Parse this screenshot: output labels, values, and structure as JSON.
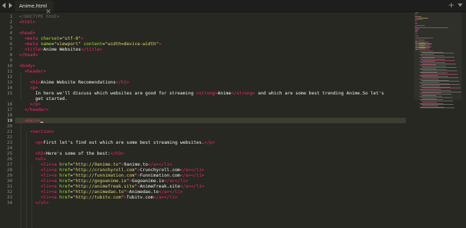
{
  "tab": {
    "label": "Anime.html"
  },
  "colors": {
    "background": "#272822",
    "tag": "#f92672",
    "attribute": "#a6e22e",
    "string": "#e6db74",
    "text": "#f8f8f2",
    "gutter_text": "#90908a"
  },
  "icons": {
    "back": "chevron-left-icon",
    "forward": "chevron-right-icon",
    "close": "close-icon",
    "new_tab": "plus-icon",
    "tab_list": "chevron-down-icon"
  },
  "editor": {
    "active_line": 19,
    "lines": [
      {
        "n": "1",
        "tokens": [
          {
            "k": "doc",
            "t": "<!DOCTYPE html>"
          }
        ]
      },
      {
        "n": "2",
        "tokens": [
          {
            "k": "tag",
            "t": "<html>"
          }
        ]
      },
      {
        "n": "3",
        "tokens": []
      },
      {
        "n": "4",
        "tokens": [
          {
            "k": "tag",
            "t": "<head>"
          }
        ]
      },
      {
        "n": "5",
        "tokens": [
          {
            "k": "txt",
            "t": "  "
          },
          {
            "k": "tag",
            "t": "<meta "
          },
          {
            "k": "attr",
            "t": "charset"
          },
          {
            "k": "txt",
            "t": "="
          },
          {
            "k": "str",
            "t": "\"utf-8\""
          },
          {
            "k": "tag",
            "t": ">"
          }
        ]
      },
      {
        "n": "6",
        "tokens": [
          {
            "k": "txt",
            "t": "  "
          },
          {
            "k": "tag",
            "t": "<meta "
          },
          {
            "k": "attr",
            "t": "name"
          },
          {
            "k": "txt",
            "t": "="
          },
          {
            "k": "str",
            "t": "\"viewport\""
          },
          {
            "k": "txt",
            "t": " "
          },
          {
            "k": "attr",
            "t": "content"
          },
          {
            "k": "txt",
            "t": "="
          },
          {
            "k": "str",
            "t": "\"width=device-width\""
          },
          {
            "k": "tag",
            "t": ">"
          }
        ]
      },
      {
        "n": "7",
        "tokens": [
          {
            "k": "txt",
            "t": "  "
          },
          {
            "k": "tag",
            "t": "<title>"
          },
          {
            "k": "txt",
            "t": "Anime Websites"
          },
          {
            "k": "tag",
            "t": "</title>"
          }
        ]
      },
      {
        "n": "8",
        "tokens": [
          {
            "k": "tag",
            "t": "</head>"
          }
        ]
      },
      {
        "n": "9",
        "tokens": []
      },
      {
        "n": "10",
        "tokens": [
          {
            "k": "tag",
            "t": "<body>"
          }
        ]
      },
      {
        "n": "11",
        "tokens": [
          {
            "k": "txt",
            "t": "  "
          },
          {
            "k": "tag",
            "t": "<header>"
          }
        ]
      },
      {
        "n": "12",
        "tokens": []
      },
      {
        "n": "13",
        "tokens": [
          {
            "k": "txt",
            "t": "    "
          },
          {
            "k": "tag",
            "t": "<h1>"
          },
          {
            "k": "txt",
            "t": "Anime Website Recomendations"
          },
          {
            "k": "tag",
            "t": "</h1>"
          }
        ]
      },
      {
        "n": "14",
        "tokens": [
          {
            "k": "txt",
            "t": "    "
          },
          {
            "k": "tag",
            "t": "<p>"
          }
        ]
      },
      {
        "n": "15",
        "tokens": [
          {
            "k": "txt",
            "t": "      In here we'll discuss which websites are good for streaming "
          },
          {
            "k": "tag",
            "t": "<strong>"
          },
          {
            "k": "txt",
            "t": "Anime"
          },
          {
            "k": "tag",
            "t": "</strong>"
          },
          {
            "k": "txt",
            "t": " and which are some best trending Anime.So let's"
          }
        ]
      },
      {
        "n": "",
        "tokens": [
          {
            "k": "txt",
            "t": "      get started."
          }
        ]
      },
      {
        "n": "16",
        "tokens": [
          {
            "k": "txt",
            "t": "    "
          },
          {
            "k": "tag",
            "t": "</p>"
          }
        ]
      },
      {
        "n": "17",
        "tokens": [
          {
            "k": "txt",
            "t": "  "
          },
          {
            "k": "tag",
            "t": "</header>"
          }
        ]
      },
      {
        "n": "18",
        "tokens": []
      },
      {
        "n": "19",
        "tokens": [
          {
            "k": "txt",
            "t": "  "
          },
          {
            "k": "tag",
            "t": "<main>"
          }
        ]
      },
      {
        "n": "20",
        "tokens": []
      },
      {
        "n": "21",
        "tokens": [
          {
            "k": "txt",
            "t": "    "
          },
          {
            "k": "tag",
            "t": "<section>"
          }
        ]
      },
      {
        "n": "22",
        "tokens": []
      },
      {
        "n": "23",
        "tokens": [
          {
            "k": "txt",
            "t": "      "
          },
          {
            "k": "tag",
            "t": "<p>"
          },
          {
            "k": "txt",
            "t": "First let's find out which are some best streaming websites."
          },
          {
            "k": "tag",
            "t": "</p>"
          }
        ]
      },
      {
        "n": "24",
        "tokens": []
      },
      {
        "n": "25",
        "tokens": [
          {
            "k": "txt",
            "t": "      "
          },
          {
            "k": "tag",
            "t": "<h3>"
          },
          {
            "k": "txt",
            "t": "Here's some of the best:"
          },
          {
            "k": "tag",
            "t": "</h3>"
          }
        ]
      },
      {
        "n": "26",
        "tokens": [
          {
            "k": "txt",
            "t": "      "
          },
          {
            "k": "tag",
            "t": "<ul>"
          }
        ]
      },
      {
        "n": "27",
        "tokens": [
          {
            "k": "txt",
            "t": "        "
          },
          {
            "k": "tag",
            "t": "<li><a "
          },
          {
            "k": "attr",
            "t": "href"
          },
          {
            "k": "txt",
            "t": "="
          },
          {
            "k": "str",
            "t": "\"http://9anime.to\""
          },
          {
            "k": "tag",
            "t": ">"
          },
          {
            "k": "txt",
            "t": "9anime.to"
          },
          {
            "k": "tag",
            "t": "</a></li>"
          }
        ]
      },
      {
        "n": "28",
        "tokens": [
          {
            "k": "txt",
            "t": "        "
          },
          {
            "k": "tag",
            "t": "<li><a "
          },
          {
            "k": "attr",
            "t": "href"
          },
          {
            "k": "txt",
            "t": "="
          },
          {
            "k": "str",
            "t": "\"http://crunchyroll.com\""
          },
          {
            "k": "tag",
            "t": ">"
          },
          {
            "k": "txt",
            "t": "Crunchyroll.com"
          },
          {
            "k": "tag",
            "t": "</a></li>"
          }
        ]
      },
      {
        "n": "29",
        "tokens": [
          {
            "k": "txt",
            "t": "        "
          },
          {
            "k": "tag",
            "t": "<li><a "
          },
          {
            "k": "attr",
            "t": "href"
          },
          {
            "k": "txt",
            "t": "="
          },
          {
            "k": "str",
            "t": "\"http://funnimation.com\""
          },
          {
            "k": "tag",
            "t": ">"
          },
          {
            "k": "txt",
            "t": "Funnimation.com"
          },
          {
            "k": "tag",
            "t": "</a></li>"
          }
        ]
      },
      {
        "n": "30",
        "tokens": [
          {
            "k": "txt",
            "t": "        "
          },
          {
            "k": "tag",
            "t": "<li><a "
          },
          {
            "k": "attr",
            "t": "href"
          },
          {
            "k": "txt",
            "t": "="
          },
          {
            "k": "str",
            "t": "\"http://gogoanime.io\""
          },
          {
            "k": "tag",
            "t": ">"
          },
          {
            "k": "txt",
            "t": "Gogoanime.io"
          },
          {
            "k": "tag",
            "t": "</a></li>"
          }
        ]
      },
      {
        "n": "31",
        "tokens": [
          {
            "k": "txt",
            "t": "        "
          },
          {
            "k": "tag",
            "t": "<li><a "
          },
          {
            "k": "attr",
            "t": "href"
          },
          {
            "k": "txt",
            "t": "="
          },
          {
            "k": "str",
            "t": "\"http://animefreak.site\""
          },
          {
            "k": "tag",
            "t": ">"
          },
          {
            "k": "txt",
            "t": "AnimeFreak.site"
          },
          {
            "k": "tag",
            "t": "</a></li>"
          }
        ]
      },
      {
        "n": "32",
        "tokens": [
          {
            "k": "txt",
            "t": "        "
          },
          {
            "k": "tag",
            "t": "<li><a "
          },
          {
            "k": "attr",
            "t": "href"
          },
          {
            "k": "txt",
            "t": "="
          },
          {
            "k": "str",
            "t": "\"http://animedao.to\""
          },
          {
            "k": "tag",
            "t": ">"
          },
          {
            "k": "txt",
            "t": "Animedao.to"
          },
          {
            "k": "tag",
            "t": "</a></li>"
          }
        ]
      },
      {
        "n": "33",
        "tokens": [
          {
            "k": "txt",
            "t": "        "
          },
          {
            "k": "tag",
            "t": "<li><a "
          },
          {
            "k": "attr",
            "t": "href"
          },
          {
            "k": "txt",
            "t": "="
          },
          {
            "k": "str",
            "t": "\"http://tubitv.com\""
          },
          {
            "k": "tag",
            "t": ">"
          },
          {
            "k": "txt",
            "t": "Tubitv.com"
          },
          {
            "k": "tag",
            "t": "</a></li>"
          }
        ]
      },
      {
        "n": "34",
        "tokens": [
          {
            "k": "txt",
            "t": "      "
          },
          {
            "k": "tag",
            "t": "</ul>"
          }
        ]
      }
    ]
  }
}
